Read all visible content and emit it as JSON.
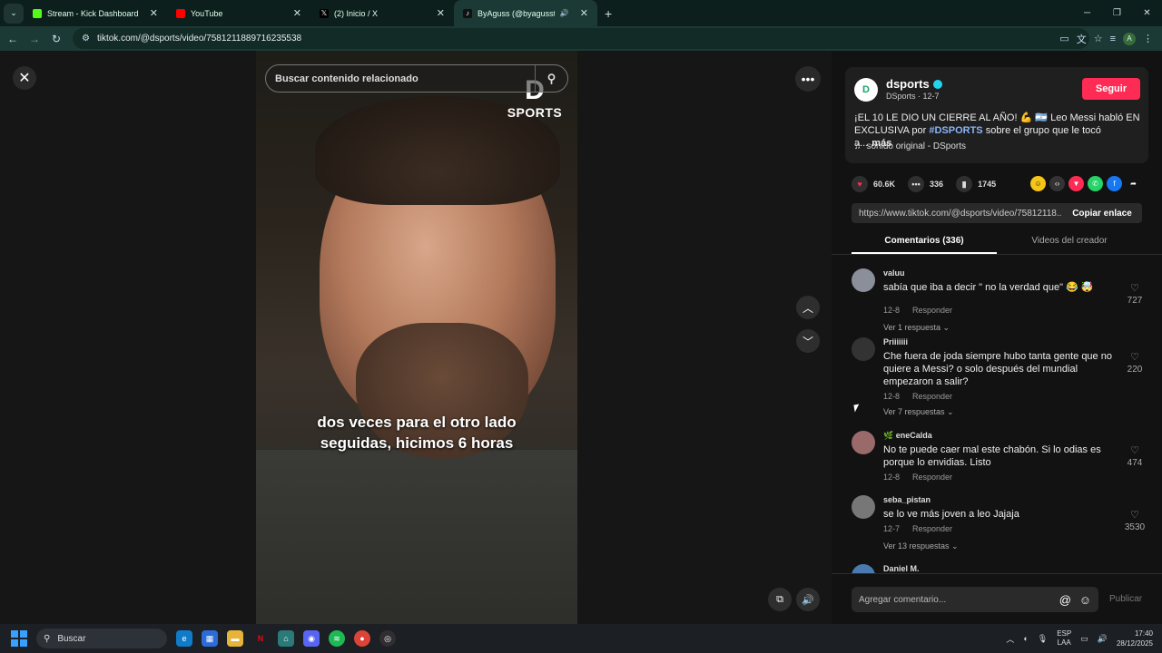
{
  "browser": {
    "tabs": [
      {
        "title": "Stream - Kick Dashboard",
        "favicon_color": "#53fc18",
        "active": false
      },
      {
        "title": "YouTube",
        "favicon_color": "#ff0000",
        "active": false
      },
      {
        "title": "(2) Inicio / X",
        "favicon_color": "#000000",
        "active": false
      },
      {
        "title": "ByAguss (@byagussteam) |",
        "favicon_color": "#ffffff",
        "active": true
      }
    ],
    "url": "tiktok.com/@dsports/video/7581211889716235538",
    "profile_initial": "A"
  },
  "video": {
    "search_placeholder": "Buscar contenido relacionado",
    "logo_top": "D",
    "logo_bottom": "SPORTS",
    "caption_line1": "dos veces para el otro lado",
    "caption_line2": "seguidas, hicimos 6 horas"
  },
  "post": {
    "username": "dsports",
    "avatar_text": "D",
    "meta": "DSports · 12-7",
    "follow_label": "Seguir",
    "desc_text": "¡EL 10 LE DIO UN CIERRE AL AÑO! 💪 🇦🇷 Leo Messi habló EN EXCLUSIVA por ",
    "desc_tag": "#DSPORTS",
    "desc_rest": " sobre el grupo que le tocó a...",
    "desc_more": "más",
    "sound": "sonido original - DSports",
    "likes": "60.6K",
    "comments": "336",
    "saves": "1745",
    "link": "https://www.tiktok.com/@dsports/video/75812118...",
    "copy_label": "Copiar enlace",
    "tab_comments": "Comentarios (336)",
    "tab_videos": "Videos del creador"
  },
  "comments": [
    {
      "user": "valuu",
      "text": "sabía que iba a decir \" no la verdad que\" 😂 🤯",
      "date": "12-8",
      "reply": "Responder",
      "replies": "Ver 1 respuesta ⌄",
      "likes": "727"
    },
    {
      "user": "Priiiiiii",
      "text": "Che fuera de joda siempre hubo tanta gente que no quiere a Messi? o solo después del mundial empezaron a salir?",
      "date": "12-8",
      "reply": "Responder",
      "replies": "Ver 7 respuestas ⌄",
      "likes": "220"
    },
    {
      "user": "🌿 eneCalda",
      "text": "No te puede caer mal este chabón. Si lo odias es porque lo envidias. Listo",
      "date": "12-8",
      "reply": "Responder",
      "replies": "",
      "likes": "474"
    },
    {
      "user": "seba_pistan",
      "text": "se lo ve más joven a leo Jajaja",
      "date": "12-7",
      "reply": "Responder",
      "replies": "Ver 13 respuestas ⌄",
      "likes": "3530"
    },
    {
      "user": "Daniel M.",
      "text": "",
      "date": "",
      "reply": "",
      "replies": "",
      "likes": ""
    }
  ],
  "composer": {
    "placeholder": "Agregar comentario...",
    "publish": "Publicar"
  },
  "taskbar": {
    "search": "Buscar",
    "lang1": "ESP",
    "lang2": "LAA",
    "time": "17:40",
    "date": "28/12/2025"
  }
}
